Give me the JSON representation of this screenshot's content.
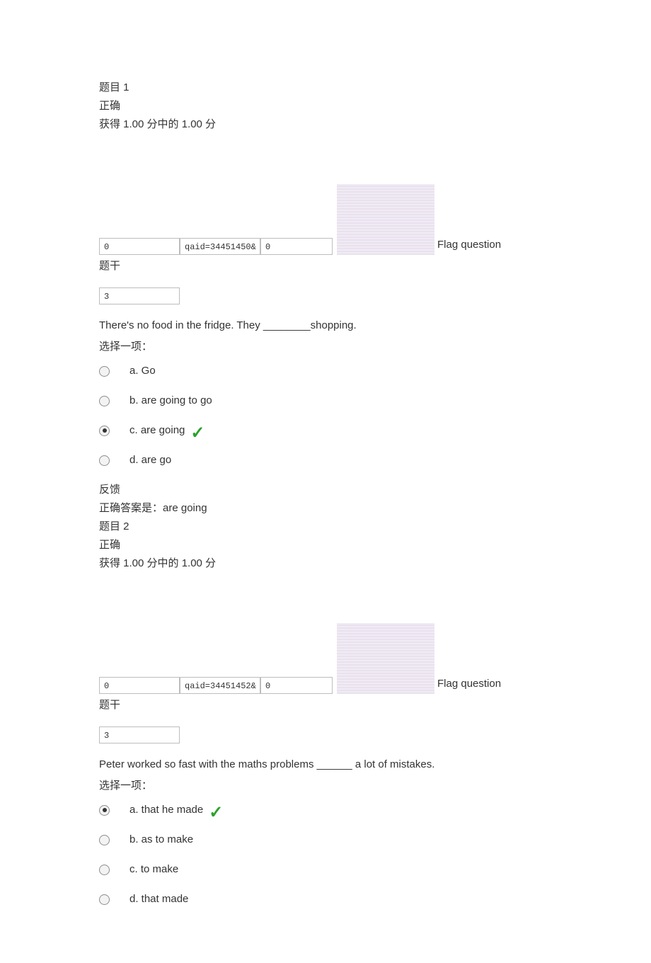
{
  "q1": {
    "title": "题目 1",
    "status": "正确",
    "score": "获得 1.00 分中的 1.00 分",
    "input_a": "0",
    "input_b": "qaid=34451450&",
    "input_c": "0",
    "flag_label": "Flag question",
    "stem_label": "题干",
    "stem_input": "3",
    "text": "There's no food in the fridge. They ________shopping.",
    "select_label": "选择一项：",
    "options": {
      "a": "a. Go",
      "b": "b. are going to go",
      "c": "c. are going",
      "d": "d. are go"
    },
    "feedback_label": "反馈",
    "correct": "正确答案是：are going"
  },
  "q2": {
    "title": "题目 2",
    "status": "正确",
    "score": "获得 1.00 分中的 1.00 分",
    "input_a": "0",
    "input_b": "qaid=34451452&",
    "input_c": "0",
    "flag_label": "Flag question",
    "stem_label": "题干",
    "stem_input": "3",
    "text": "Peter worked so fast with the maths problems ______ a lot of mistakes.",
    "select_label": "选择一项：",
    "options": {
      "a": "a. that he made",
      "b": "b. as to make",
      "c": "c. to make",
      "d": "d. that made"
    }
  }
}
